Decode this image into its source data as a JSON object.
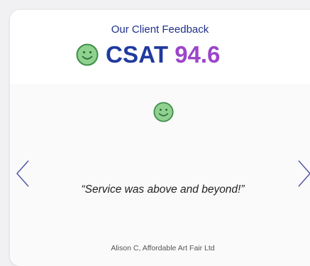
{
  "header": {
    "title": "Our Client Feedback",
    "csat_label": "CSAT",
    "csat_score": "94.6"
  },
  "icons": {
    "header_icon": "smiley-face-icon",
    "testimonial_icon": "smiley-face-icon",
    "prev": "chevron-left-icon",
    "next": "chevron-right-icon"
  },
  "testimonial": {
    "quote": "“Service was above and beyond!”",
    "author": "Alison C, Affordable Art Fair Ltd"
  },
  "colors": {
    "title": "#1f2f8a",
    "csat_label": "#203a9e",
    "csat_score": "#9b45c9",
    "smiley_fill": "#8fd18f",
    "smiley_stroke": "#3f8f4a",
    "arrow": "#4a4fa8"
  }
}
